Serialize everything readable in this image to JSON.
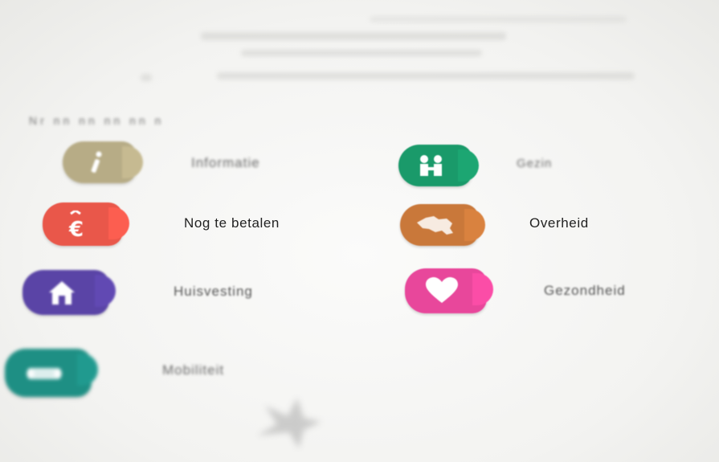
{
  "legend": {
    "top_numbers": "Nr   nn   nn   nn   nn   n",
    "items": [
      {
        "label": "Informatie",
        "icon": "info-icon",
        "color": "#b7ac86"
      },
      {
        "label": "Gezin",
        "icon": "family-icon",
        "color": "#1a9a6a"
      },
      {
        "label": "Nog te betalen",
        "icon": "euro-icon",
        "color": "#e9574a"
      },
      {
        "label": "Overheid",
        "icon": "belgium-map-icon",
        "color": "#c9783a"
      },
      {
        "label": "Huisvesting",
        "icon": "house-icon",
        "color": "#5a44a6"
      },
      {
        "label": "Gezondheid",
        "icon": "heart-icon",
        "color": "#e8479b"
      },
      {
        "label": "Mobiliteit",
        "icon": "car-icon",
        "color": "#1e8f84"
      }
    ]
  }
}
